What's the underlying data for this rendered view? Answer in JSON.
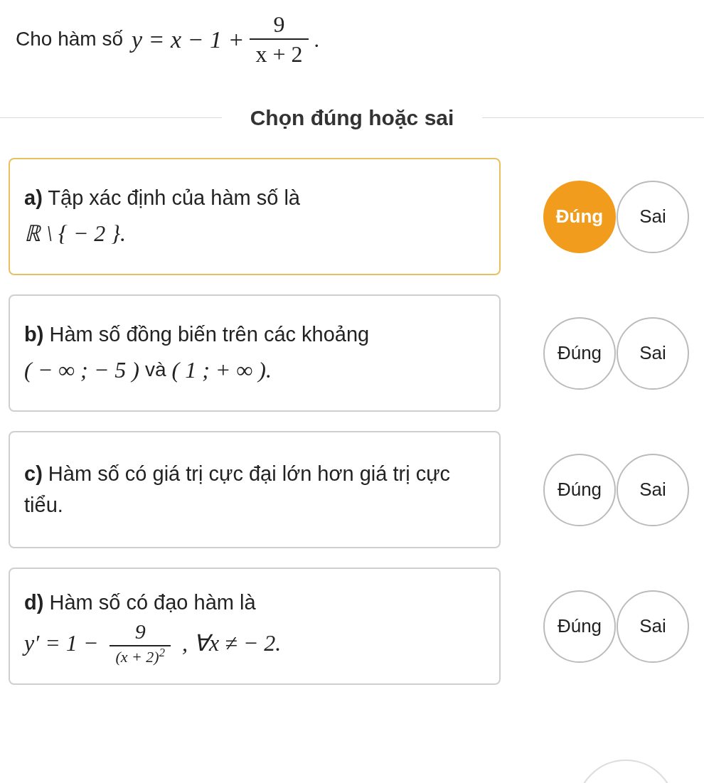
{
  "question": {
    "prefix": "Cho hàm số",
    "formula": "y = x − 1 +",
    "fraction": {
      "numerator": "9",
      "denominator": "x + 2"
    },
    "suffix": "."
  },
  "instruction": "Chọn đúng hoặc sai",
  "statements": [
    {
      "label": "a)",
      "text": "Tập xác định của hàm số là",
      "math": [
        {
          "kind": "text",
          "value": "ℝ \\ { − 2 }."
        }
      ],
      "options": [
        {
          "label": "Đúng",
          "selected": true
        },
        {
          "label": "Sai",
          "selected": false
        }
      ]
    },
    {
      "label": "b)",
      "text": "Hàm số đồng biến trên các khoảng",
      "math": [
        {
          "kind": "text",
          "value": "( − ∞ ; − 5 )"
        },
        {
          "kind": "plain",
          "value": "và"
        },
        {
          "kind": "text",
          "value": "( 1 ; + ∞ )."
        }
      ],
      "options": [
        {
          "label": "Đúng",
          "selected": false
        },
        {
          "label": "Sai",
          "selected": false
        }
      ]
    },
    {
      "label": "c)",
      "text": "Hàm số có giá trị cực đại lớn hơn giá trị cực tiểu.",
      "options": [
        {
          "label": "Đúng",
          "selected": false
        },
        {
          "label": "Sai",
          "selected": false
        }
      ]
    },
    {
      "label": "d)",
      "text": "Hàm số có đạo hàm là",
      "math": [
        {
          "kind": "text",
          "value": "y′ = 1 −"
        },
        {
          "kind": "fraction",
          "numerator": "9",
          "denominator": "(x + 2)$^{2}$"
        },
        {
          "kind": "text",
          "value": ", ∀x ≠ − 2."
        }
      ],
      "options": [
        {
          "label": "Đúng",
          "selected": false
        },
        {
          "label": "Sai",
          "selected": false
        }
      ]
    }
  ]
}
